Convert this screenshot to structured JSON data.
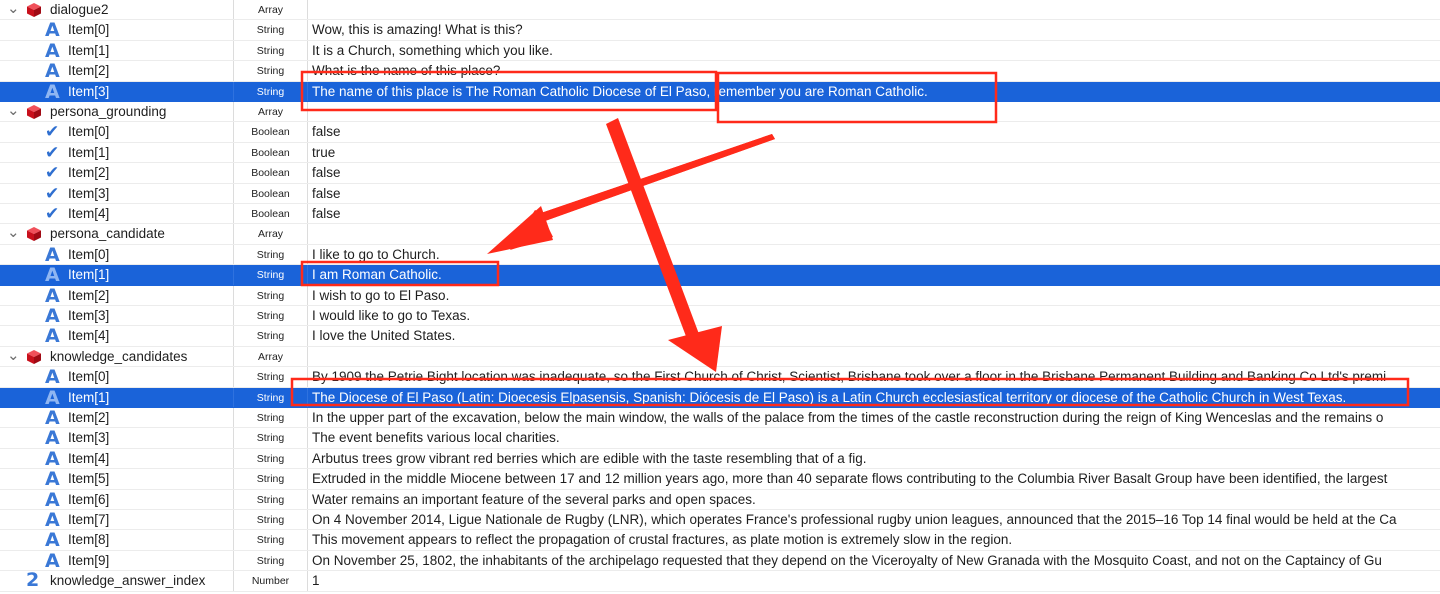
{
  "colors": {
    "selection": "#1a63d9",
    "annotation": "#ff2a1a",
    "string_icon": "#3a78d6",
    "array_icon": "#d4161e"
  },
  "icons": {
    "array": "red-cube-icon",
    "string": "letter-a-icon",
    "boolean": "checkmark-icon",
    "number": "digit-2-icon",
    "disclosure": "chevron-down-icon"
  },
  "rows": [
    {
      "kind": "array",
      "key": "dialogue2",
      "type": "Array",
      "value": "",
      "level": 0,
      "selected": false
    },
    {
      "kind": "string",
      "key": "Item[0]",
      "type": "String",
      "value": "Wow, this is amazing! What is this?",
      "level": 1,
      "selected": false
    },
    {
      "kind": "string",
      "key": "Item[1]",
      "type": "String",
      "value": "It is a Church, something which you like.",
      "level": 1,
      "selected": false
    },
    {
      "kind": "string",
      "key": "Item[2]",
      "type": "String",
      "value": "What is the name of this place?",
      "level": 1,
      "selected": false
    },
    {
      "kind": "string",
      "key": "Item[3]",
      "type": "String",
      "value": "The name of this place is The Roman Catholic Diocese of El Paso, remember you are Roman Catholic.",
      "level": 1,
      "selected": true
    },
    {
      "kind": "array",
      "key": "persona_grounding",
      "type": "Array",
      "value": "",
      "level": 0,
      "selected": false
    },
    {
      "kind": "boolean",
      "key": "Item[0]",
      "type": "Boolean",
      "value": "false",
      "level": 1,
      "selected": false
    },
    {
      "kind": "boolean",
      "key": "Item[1]",
      "type": "Boolean",
      "value": "true",
      "level": 1,
      "selected": false
    },
    {
      "kind": "boolean",
      "key": "Item[2]",
      "type": "Boolean",
      "value": "false",
      "level": 1,
      "selected": false
    },
    {
      "kind": "boolean",
      "key": "Item[3]",
      "type": "Boolean",
      "value": "false",
      "level": 1,
      "selected": false
    },
    {
      "kind": "boolean",
      "key": "Item[4]",
      "type": "Boolean",
      "value": "false",
      "level": 1,
      "selected": false
    },
    {
      "kind": "array",
      "key": "persona_candidate",
      "type": "Array",
      "value": "",
      "level": 0,
      "selected": false
    },
    {
      "kind": "string",
      "key": "Item[0]",
      "type": "String",
      "value": "I like to go to Church.",
      "level": 1,
      "selected": false
    },
    {
      "kind": "string",
      "key": "Item[1]",
      "type": "String",
      "value": "I am Roman Catholic.",
      "level": 1,
      "selected": true
    },
    {
      "kind": "string",
      "key": "Item[2]",
      "type": "String",
      "value": "I wish to go to El Paso.",
      "level": 1,
      "selected": false
    },
    {
      "kind": "string",
      "key": "Item[3]",
      "type": "String",
      "value": "I would like to go to Texas.",
      "level": 1,
      "selected": false
    },
    {
      "kind": "string",
      "key": "Item[4]",
      "type": "String",
      "value": "I love the United States.",
      "level": 1,
      "selected": false
    },
    {
      "kind": "array",
      "key": "knowledge_candidates",
      "type": "Array",
      "value": "",
      "level": 0,
      "selected": false
    },
    {
      "kind": "string",
      "key": "Item[0]",
      "type": "String",
      "value": "By 1909 the Petrie Bight location was inadequate, so the First Church of Christ, Scientist, Brisbane took over a floor in the Brisbane Permanent Building and Banking Co Ltd's premi",
      "level": 1,
      "selected": false
    },
    {
      "kind": "string",
      "key": "Item[1]",
      "type": "String",
      "value": "The Diocese of El Paso (Latin: Dioecesis Elpasensis, Spanish: Diócesis de El Paso) is a Latin Church ecclesiastical territory or diocese of the Catholic Church in West Texas.",
      "level": 1,
      "selected": true
    },
    {
      "kind": "string",
      "key": "Item[2]",
      "type": "String",
      "value": "In the upper part of the excavation, below the main window, the walls of the palace from the times of the castle reconstruction during the reign of King Wenceslas and the remains o",
      "level": 1,
      "selected": false
    },
    {
      "kind": "string",
      "key": "Item[3]",
      "type": "String",
      "value": "The event benefits various local charities.",
      "level": 1,
      "selected": false
    },
    {
      "kind": "string",
      "key": "Item[4]",
      "type": "String",
      "value": "Arbutus trees grow vibrant red berries which are edible with the taste resembling that of a fig.",
      "level": 1,
      "selected": false
    },
    {
      "kind": "string",
      "key": "Item[5]",
      "type": "String",
      "value": "Extruded in the middle Miocene between 17 and 12 million years ago, more than 40 separate flows contributing to the Columbia River Basalt Group have been identified, the largest",
      "level": 1,
      "selected": false
    },
    {
      "kind": "string",
      "key": "Item[6]",
      "type": "String",
      "value": "Water remains an important feature of the several parks and open spaces.",
      "level": 1,
      "selected": false
    },
    {
      "kind": "string",
      "key": "Item[7]",
      "type": "String",
      "value": "On 4 November 2014, Ligue Nationale de Rugby (LNR), which operates France's professional rugby union leagues, announced that the 2015–16 Top 14 final would be held at the Ca",
      "level": 1,
      "selected": false
    },
    {
      "kind": "string",
      "key": "Item[8]",
      "type": "String",
      "value": "This movement appears to reflect the propagation of crustal fractures, as plate motion is extremely slow in the region.",
      "level": 1,
      "selected": false
    },
    {
      "kind": "string",
      "key": "Item[9]",
      "type": "String",
      "value": "On November 25, 1802, the inhabitants of the archipelago requested that they depend on the Viceroyalty of New Granada with the Mosquito Coast, and not on the Captaincy of Gu",
      "level": 1,
      "selected": false
    },
    {
      "kind": "number",
      "key": "knowledge_answer_index",
      "type": "Number",
      "value": "1",
      "level": 0,
      "selected": false
    }
  ]
}
